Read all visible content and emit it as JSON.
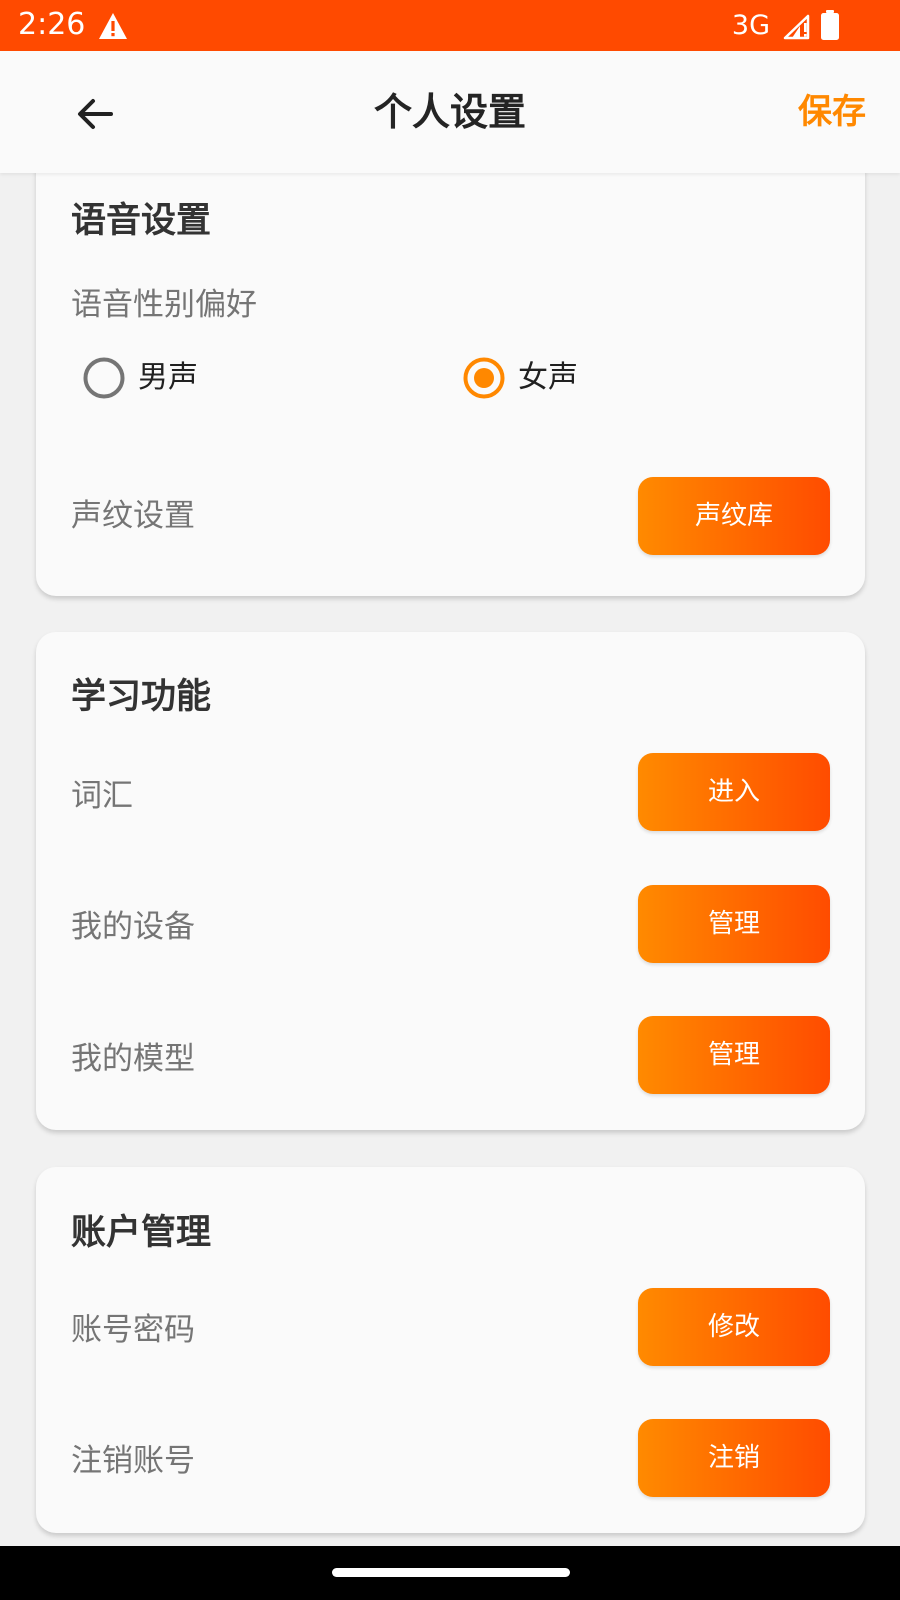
{
  "status_bar": {
    "time": "2:26",
    "network": "3G",
    "icons": [
      "warning-icon",
      "signal-icon",
      "battery-icon"
    ],
    "background": "#ff4a00"
  },
  "header": {
    "title": "个人设置",
    "back_icon": "arrow-left-icon",
    "save_label": "保存",
    "save_color": "#ff8800"
  },
  "voice_settings": {
    "title": "语音设置",
    "gender_label": "语音性别偏好",
    "options": [
      {
        "label": "男声",
        "selected": false
      },
      {
        "label": "女声",
        "selected": true
      }
    ],
    "voiceprint_label": "声纹设置",
    "voiceprint_button": "声纹库"
  },
  "learning": {
    "title": "学习功能",
    "rows": [
      {
        "label": "词汇",
        "button": "进入"
      },
      {
        "label": "我的设备",
        "button": "管理"
      },
      {
        "label": "我的模型",
        "button": "管理"
      }
    ]
  },
  "account": {
    "title": "账户管理",
    "rows": [
      {
        "label": "账号密码",
        "button": "修改"
      },
      {
        "label": "注销账号",
        "button": "注销"
      }
    ]
  },
  "accent": {
    "gradient_start": "#ff8a00",
    "gradient_end": "#ff4c00"
  }
}
